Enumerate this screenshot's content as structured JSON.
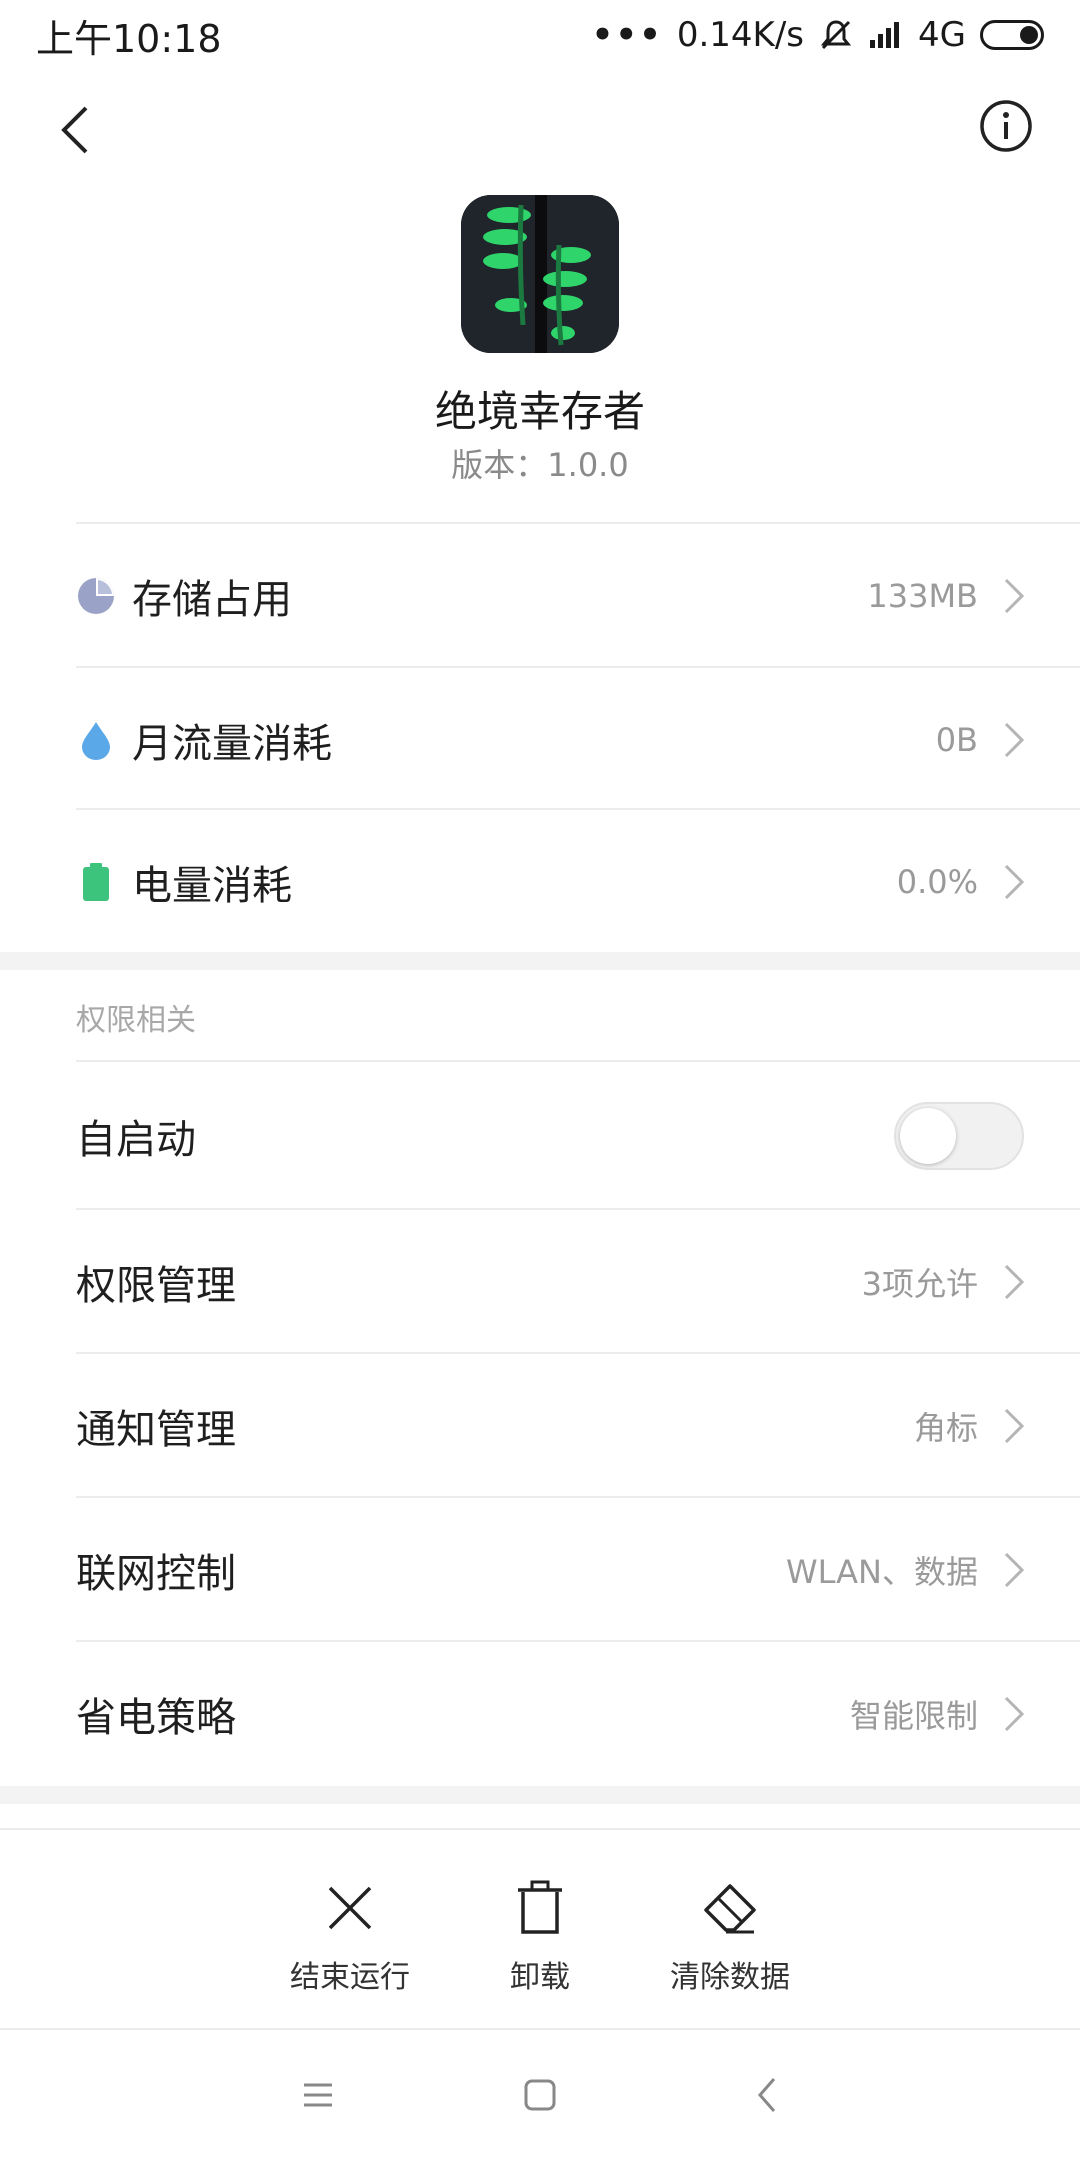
{
  "status_bar": {
    "time": "上午10:18",
    "network_speed": "0.14K/s",
    "network_type": "4G"
  },
  "app": {
    "name": "绝境幸存者",
    "version": "版本：1.0.0"
  },
  "usage": [
    {
      "label": "存储占用",
      "value": "133MB",
      "icon": "pie-chart-icon",
      "color": "#9aa3c7"
    },
    {
      "label": "月流量消耗",
      "value": "0B",
      "icon": "water-drop-icon",
      "color": "#5aa8e8"
    },
    {
      "label": "电量消耗",
      "value": "0.0%",
      "icon": "battery-icon",
      "color": "#3cc47c"
    }
  ],
  "permissions": {
    "section_title": "权限相关",
    "autostart": {
      "label": "自启动",
      "enabled": false
    },
    "items": [
      {
        "label": "权限管理",
        "value": "3项允许"
      },
      {
        "label": "通知管理",
        "value": "角标"
      },
      {
        "label": "联网控制",
        "value": "WLAN、数据"
      },
      {
        "label": "省电策略",
        "value": "智能限制"
      }
    ]
  },
  "actions": [
    {
      "label": "结束运行",
      "icon": "close-icon"
    },
    {
      "label": "卸载",
      "icon": "trash-icon"
    },
    {
      "label": "清除数据",
      "icon": "eraser-icon"
    }
  ]
}
